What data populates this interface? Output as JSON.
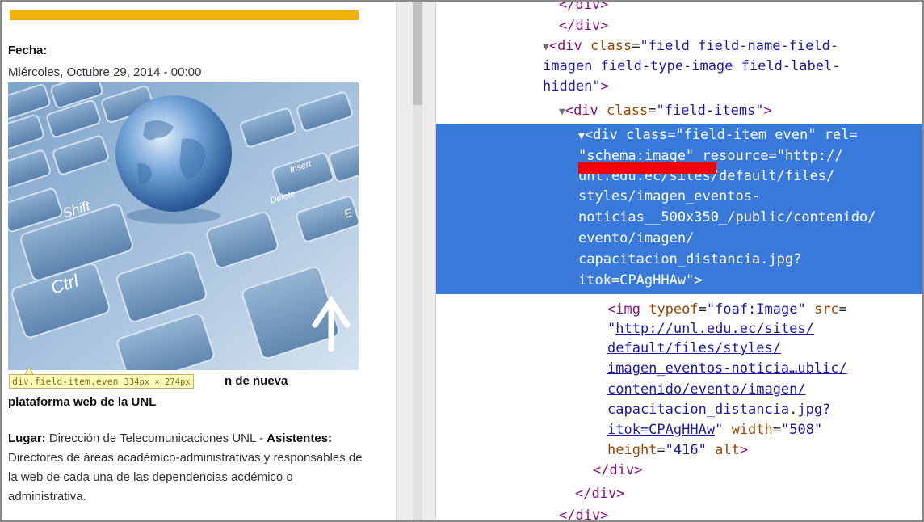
{
  "page": {
    "fecha_label": "Fecha:",
    "fecha_value": "Miércoles, Octubre 29, 2014 - 00:00",
    "title_tail": "n de nueva",
    "title_line2": "plataforma web de  la UNL",
    "lugar_label": "Lugar:",
    "lugar_text": " Dirección de Telecomunicaciones UNL - ",
    "asistentes_label": "Asistentes:",
    "asistentes_text": " Directores de áreas académico-administrativas y responsables de la web de cada una de las dependencias acdémico o administrativa."
  },
  "tooltip": {
    "selector": "div.field-item.even",
    "size": "334px × 274px"
  },
  "keyboard_keys": [
    "Shift",
    "Ctrl",
    "Delete",
    "Insert",
    "E"
  ],
  "devtools": {
    "close_div_top": "</div>",
    "div1_tag_open": "<div",
    "div1_attr": "class",
    "div1_val_1": "\"field field-name-field-",
    "div1_val_2": "imagen field-type-image field-label-",
    "div1_val_3": "hidden\"",
    "div1_close": ">",
    "div2_tag_open": "<div",
    "div2_attr": "class",
    "div2_val": "\"field-items\"",
    "div2_close": ">",
    "sel_tag_open": "<div",
    "sel_attr1": "class",
    "sel_val1": "\"field-item even\"",
    "sel_attr2": "rel",
    "sel_val2": "\"schema:image\"",
    "sel_attr3": "resource",
    "sel_val3_1": "\"http://",
    "sel_val3_2": "unl.edu.ec/sites/default/files/",
    "sel_val3_3": "styles/imagen_eventos-",
    "sel_val3_4": "noticias__500x350_/public/contenido/",
    "sel_val3_5": "evento/imagen/",
    "sel_val3_6": "capacitacion_distancia.jpg?",
    "sel_val3_7": "itok=CPAgHHAw\"",
    "sel_close": ">",
    "img_tag_open": "<img",
    "img_attr1": "typeof",
    "img_val1": "\"foaf:Image\"",
    "img_attr2": "src",
    "img_quote": "\"",
    "img_src_1": "http://unl.edu.ec/sites/",
    "img_src_2": "default/files/styles/",
    "img_src_3": "imagen_eventos-noticia…ublic/",
    "img_src_4": "contenido/evento/imagen/",
    "img_src_5": "capacitacion_distancia.jpg?",
    "img_src_6": "itok=CPAgHHAw",
    "img_attr3": "width",
    "img_val3": "\"508\"",
    "img_attr4": "height",
    "img_val4": "\"416\"",
    "img_attr5": "alt",
    "img_close": ">",
    "close_div_1": "</div>",
    "close_div_2": "</div>",
    "close_div_3": "</div>"
  },
  "colors": {
    "gold_bar": "#f0b10c",
    "selection": "#3879d9",
    "tag": "#881280",
    "attr_name": "#994500",
    "attr_value": "#1a1aa6",
    "redaction": "#ee0000"
  }
}
